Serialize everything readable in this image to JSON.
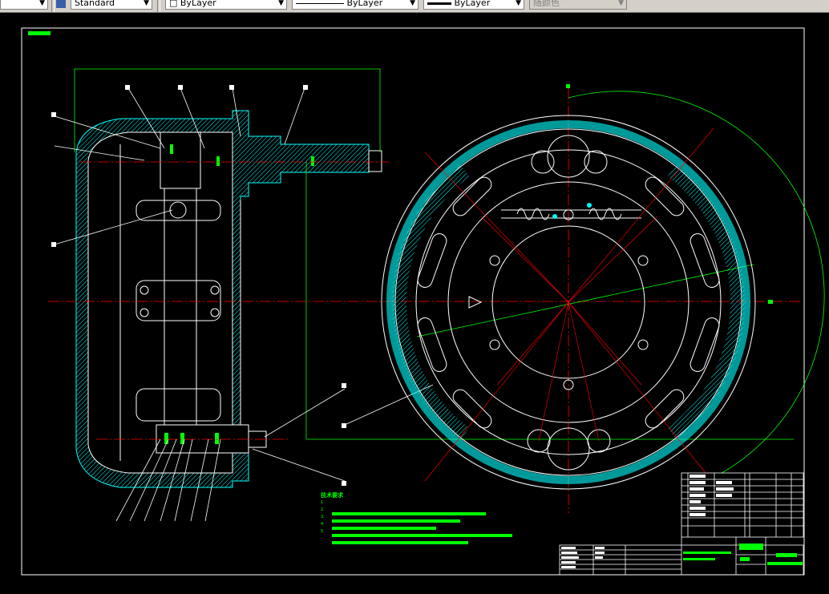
{
  "toolbar": {
    "text_style": "Standard",
    "color": "ByLayer",
    "linetype": "ByLayer",
    "lineweight": "ByLayer",
    "plot_style": "随颜色"
  },
  "drawing": {
    "notes_heading": "技术要求",
    "notes": [
      "1.",
      "2.",
      "3.",
      "4.",
      "5."
    ],
    "colors": {
      "outline": "#ffffff",
      "hatch": "#00ffff",
      "centerline": "#ff0000",
      "dimension": "#00ff00",
      "background": "#000000"
    }
  }
}
